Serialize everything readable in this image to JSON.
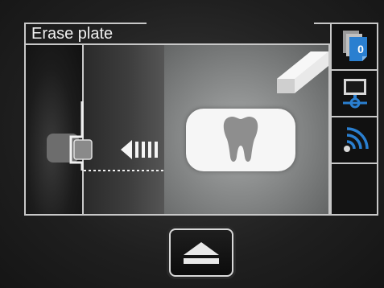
{
  "screen": {
    "title": "Erase plate"
  },
  "sidebar": {
    "plates_button": {
      "icon": "image-plates-icon",
      "count": "0"
    },
    "monitor_button": {
      "icon": "monitor-network-icon"
    },
    "wireless_button": {
      "icon": "wireless-signal-icon"
    }
  },
  "illustration": {
    "icons": [
      "scanner-slot-icon",
      "insert-arrow-icon",
      "tooth-plate-icon",
      "eraser-icon"
    ]
  },
  "footer": {
    "eject_button": {
      "icon": "eject-icon"
    }
  },
  "colors": {
    "accent_blue": "#2a7fd0",
    "frame_line": "#c8c8c8",
    "background": "#1f1f1f"
  }
}
